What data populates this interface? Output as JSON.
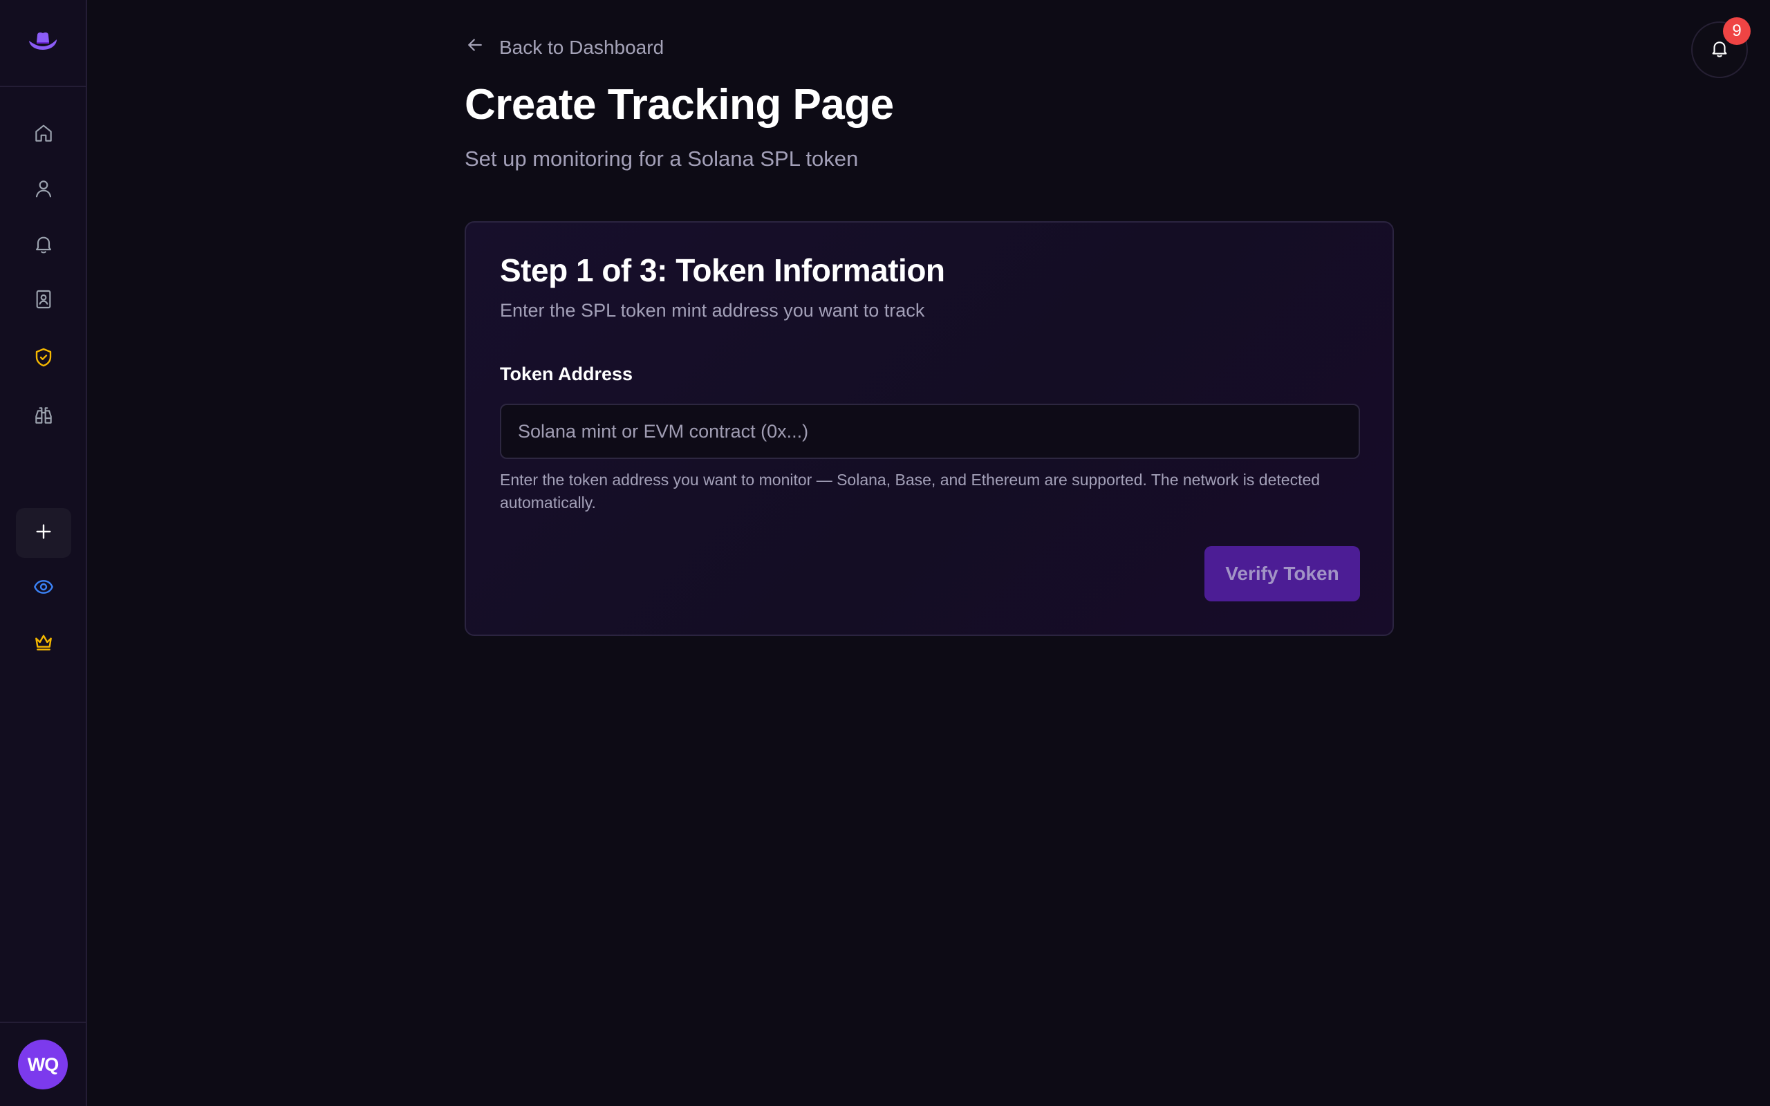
{
  "sidebar": {
    "logo_icon": "cowboy-hat-icon",
    "nav": [
      {
        "icon": "home-icon",
        "color": "#9ca3af"
      },
      {
        "icon": "user-icon",
        "color": "#9ca3af"
      },
      {
        "icon": "bell-icon",
        "color": "#9ca3af"
      },
      {
        "icon": "contact-book-icon",
        "color": "#9ca3af"
      },
      {
        "icon": "shield-check-icon",
        "color": "#f5b800"
      },
      {
        "icon": "binoculars-icon",
        "color": "#9ca3af"
      },
      {
        "icon": "plus-icon",
        "color": "#ffffff"
      },
      {
        "icon": "eye-icon",
        "color": "#3b82f6"
      },
      {
        "icon": "crown-icon",
        "color": "#f5b800"
      }
    ],
    "avatar_initials": "WQ"
  },
  "header": {
    "notification_count": "9"
  },
  "main": {
    "back_label": "Back to Dashboard",
    "title": "Create Tracking Page",
    "subtitle": "Set up monitoring for a Solana SPL token"
  },
  "card": {
    "title": "Step 1 of 3: Token Information",
    "subtitle": "Enter the SPL token mint address you want to track",
    "field_label": "Token Address",
    "input_value": "",
    "input_placeholder": "Solana mint or EVM contract (0x...)",
    "help_text": "Enter the token address you want to monitor — Solana, Base, and Ethereum are supported. The network is detected automatically.",
    "verify_label": "Verify Token"
  },
  "colors": {
    "accent": "#7c3aed",
    "background": "#0d0b15",
    "sidebar": "#120d1f",
    "badge": "#ef4444",
    "warning": "#f5b800",
    "info": "#3b82f6"
  }
}
